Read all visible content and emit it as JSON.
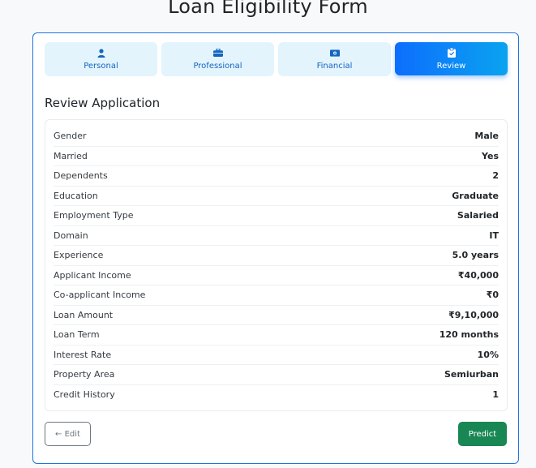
{
  "page": {
    "title": "Loan Eligibility Form"
  },
  "tabs": [
    {
      "label": "Personal",
      "icon": "person-icon",
      "active": false
    },
    {
      "label": "Professional",
      "icon": "briefcase-icon",
      "active": false
    },
    {
      "label": "Financial",
      "icon": "cash-icon",
      "active": false
    },
    {
      "label": "Review",
      "icon": "clipboard-check-icon",
      "active": true
    }
  ],
  "review": {
    "title": "Review Application",
    "rows": [
      {
        "label": "Gender",
        "value": "Male"
      },
      {
        "label": "Married",
        "value": "Yes"
      },
      {
        "label": "Dependents",
        "value": "2"
      },
      {
        "label": "Education",
        "value": "Graduate"
      },
      {
        "label": "Employment Type",
        "value": "Salaried"
      },
      {
        "label": "Domain",
        "value": "IT"
      },
      {
        "label": "Experience",
        "value": "5.0 years"
      },
      {
        "label": "Applicant Income",
        "value": "₹40,000"
      },
      {
        "label": "Co-applicant Income",
        "value": "₹0"
      },
      {
        "label": "Loan Amount",
        "value": "₹9,10,000"
      },
      {
        "label": "Loan Term",
        "value": "120 months"
      },
      {
        "label": "Interest Rate",
        "value": "10%"
      },
      {
        "label": "Property Area",
        "value": "Semiurban"
      },
      {
        "label": "Credit History",
        "value": "1"
      }
    ]
  },
  "actions": {
    "edit_label": "← Edit",
    "predict_label": "Predict"
  },
  "colors": {
    "accent": "#0d6efd",
    "tab_bg": "#e3f4fd",
    "success": "#198754",
    "card_border": "#1a73e8"
  }
}
